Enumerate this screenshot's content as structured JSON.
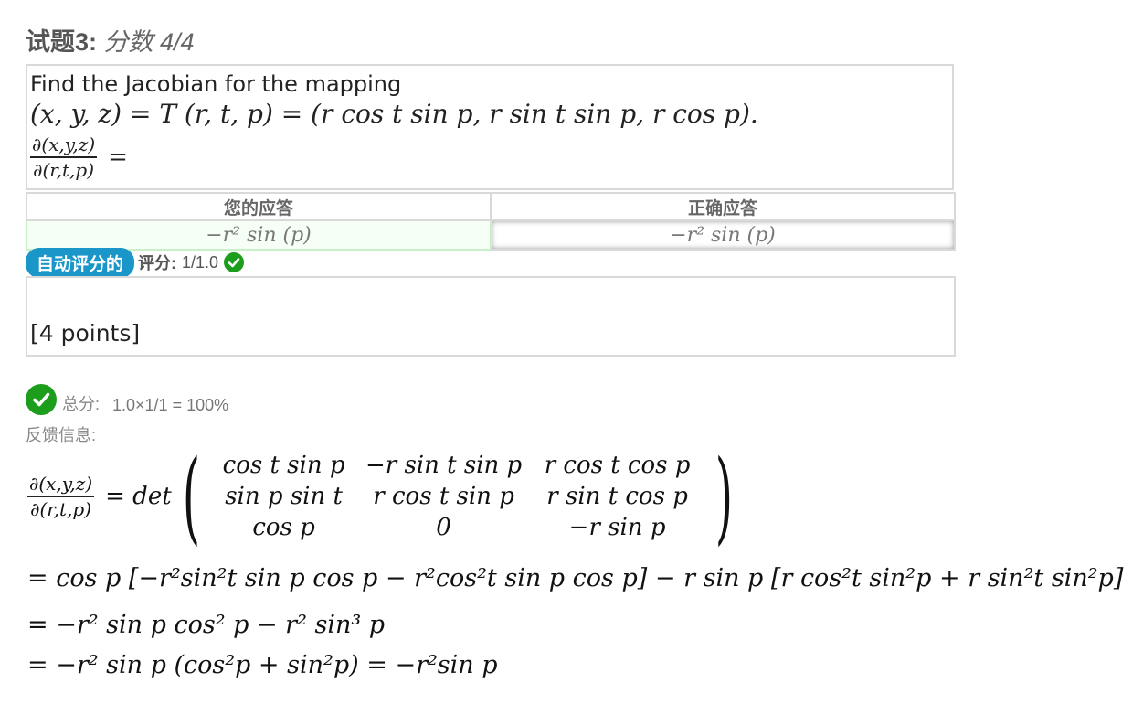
{
  "question": {
    "title_label": "试题3:",
    "score_label": "分数 4/4",
    "prompt": "Find the Jacobian for the mapping",
    "mapping_equation": "(x, y, z) = T (r, t, p) = (r cos t sin p, r sin t sin p, r cos p).",
    "jacobian_numerator": "∂(x,y,z)",
    "jacobian_denominator": "∂(r,t,p)",
    "jacobian_equals": "="
  },
  "answers": {
    "your_answer_header": "您的应答",
    "correct_answer_header": "正确应答",
    "your_answer": "−r² sin (p)",
    "correct_answer": "−r² sin (p)"
  },
  "grading": {
    "auto_badge": "自动评分的",
    "score_label": "评分:",
    "score_value": "1/1.0"
  },
  "points_box": "[4 points]",
  "total": {
    "label": "总分:",
    "value": "1.0×1/1 = 100%"
  },
  "feedback": {
    "label": "反馈信息:",
    "det_prefix": "= det",
    "matrix": [
      [
        "cos t sin p",
        "−r  sin  t  sin  p",
        "r cos t cos p"
      ],
      [
        "sin p sin t",
        "r cos t sin p",
        "r sin t cos p"
      ],
      [
        "cos p",
        "0",
        "−r sin p"
      ]
    ],
    "line2": "= cos p [−r²sin²t sin p cos p − r²cos²t sin p cos p]  −  r sin p [r cos²t sin²p  +  r sin²t sin²p]",
    "line3": "= −r² sin p cos² p  −  r² sin³ p",
    "line4": "= −r² sin p  (cos²p  +  sin²p)  =  −r²sin p"
  },
  "colors": {
    "badge": "#1a96c8",
    "check": "#1c9d1c",
    "border": "#d9d9d9"
  }
}
